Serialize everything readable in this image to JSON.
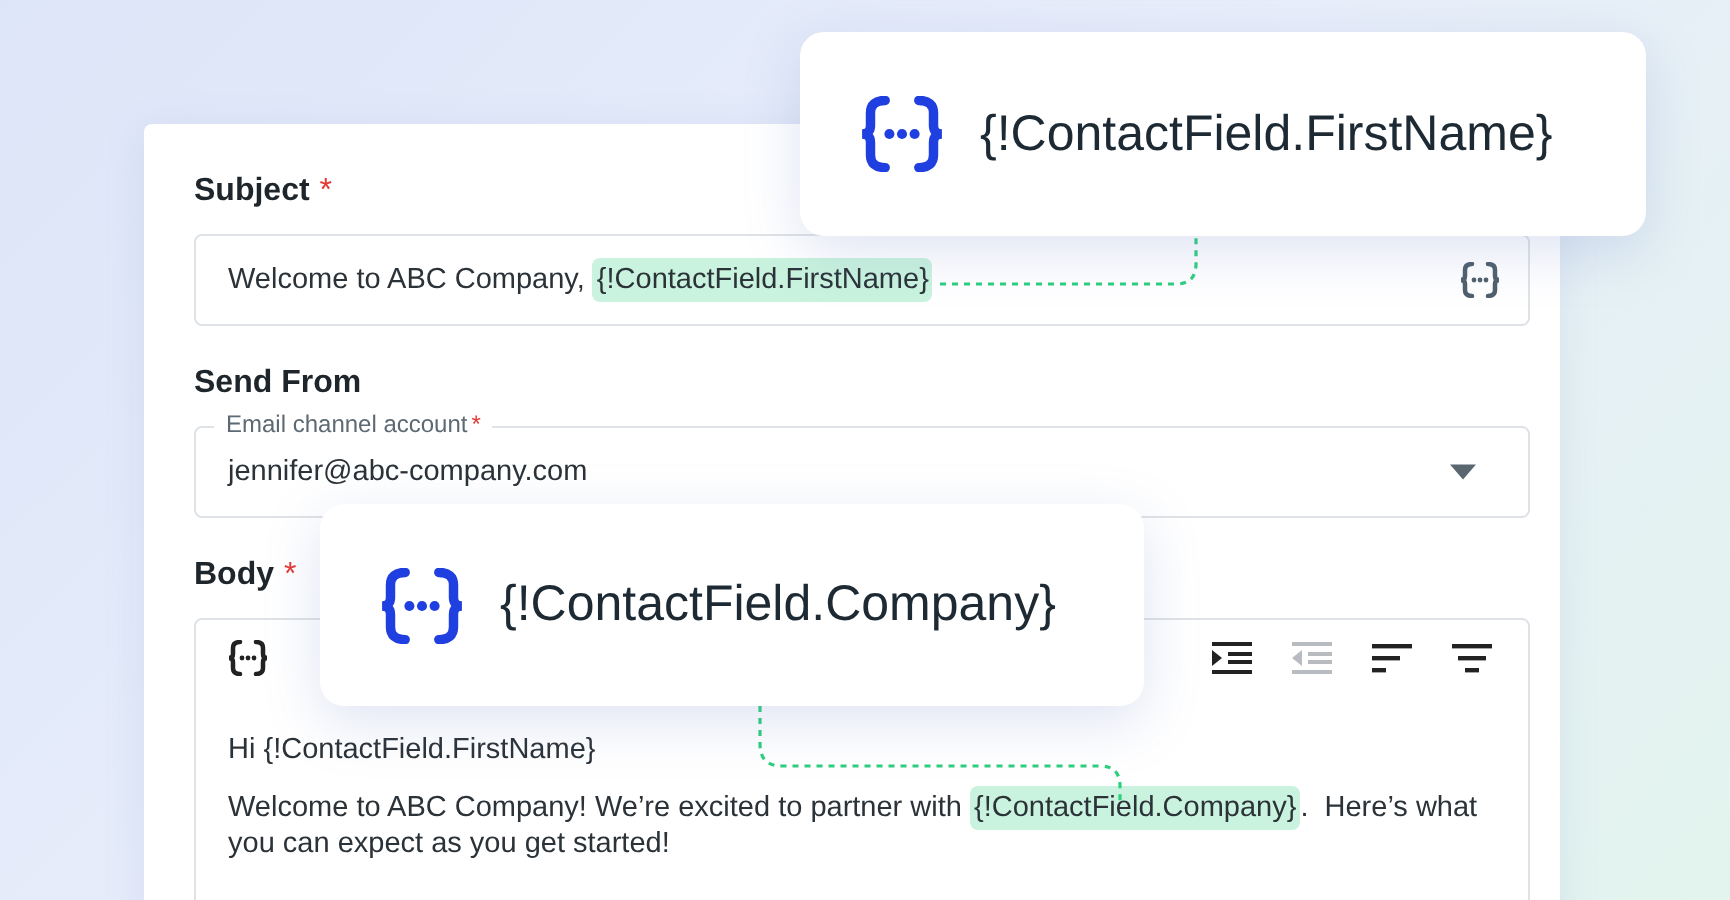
{
  "subject": {
    "label": "Subject",
    "required_mark": "*",
    "text": "Welcome to ABC Company, ",
    "token": "{!ContactField.FirstName}"
  },
  "send_from": {
    "label": "Send From",
    "field_label": "Email channel account",
    "required_mark": "*",
    "value": "jennifer@abc-company.com"
  },
  "body": {
    "label": "Body",
    "required_mark": "*",
    "toolbar": [
      {
        "kind": "variable",
        "disabled": false
      },
      {
        "kind": "indent",
        "disabled": false
      },
      {
        "kind": "outdent",
        "disabled": true
      },
      {
        "kind": "align-left",
        "disabled": false
      },
      {
        "kind": "align-center",
        "disabled": false
      }
    ],
    "greeting": "Hi {!ContactField.FirstName}",
    "paragraph": {
      "before": "Welcome to ABC Company! We’re excited to partner with ",
      "token": "{!ContactField.Company}",
      "after": ".  Here’s what you can expect as you get started!"
    }
  },
  "callouts": [
    {
      "text": "{!ContactField.FirstName}"
    },
    {
      "text": "{!ContactField.Company}"
    }
  ]
}
